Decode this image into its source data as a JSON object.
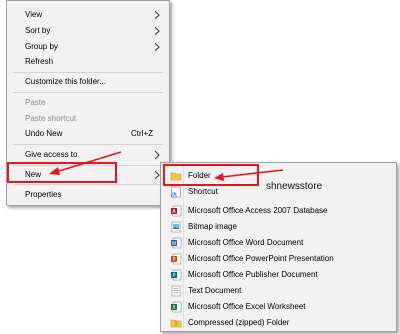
{
  "context_menu": {
    "items": [
      {
        "label": "View"
      },
      {
        "label": "Sort by"
      },
      {
        "label": "Group by"
      },
      {
        "label": "Refresh"
      },
      {
        "label": "Customize this folder..."
      },
      {
        "label": "Paste"
      },
      {
        "label": "Paste shortcut"
      },
      {
        "label": "Undo New",
        "shortcut": "Ctrl+Z"
      },
      {
        "label": "Give access to"
      },
      {
        "label": "New"
      },
      {
        "label": "Properties"
      }
    ]
  },
  "new_submenu": {
    "items": [
      {
        "label": "Folder",
        "icon": "folder-icon"
      },
      {
        "label": "Shortcut",
        "icon": "shortcut-icon"
      },
      {
        "label": "Microsoft Office Access 2007 Database",
        "icon": "access-icon"
      },
      {
        "label": "Bitmap image",
        "icon": "bitmap-icon"
      },
      {
        "label": "Microsoft Office Word Document",
        "icon": "word-icon"
      },
      {
        "label": "Microsoft Office PowerPoint Presentation",
        "icon": "powerpoint-icon"
      },
      {
        "label": "Microsoft Office Publisher Document",
        "icon": "publisher-icon"
      },
      {
        "label": "Text Document",
        "icon": "text-document-icon"
      },
      {
        "label": "Microsoft Office Excel Worksheet",
        "icon": "excel-icon"
      },
      {
        "label": "Compressed (zipped) Folder",
        "icon": "zip-folder-icon"
      }
    ]
  },
  "watermark": "shnewsstore",
  "colors": {
    "highlight_border": "#e8141b",
    "menu_background": "#f2f2f2"
  }
}
